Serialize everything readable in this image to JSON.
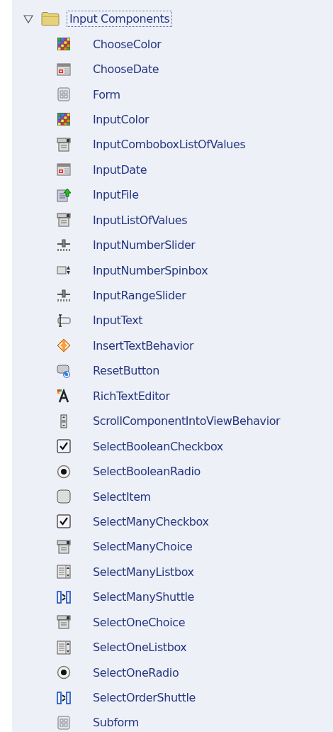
{
  "tree": {
    "label": "Input Components",
    "expanded": true,
    "selected": true,
    "children": [
      {
        "label": "ChooseColor",
        "kind": "color",
        "selected": false
      },
      {
        "label": "ChooseDate",
        "kind": "date",
        "selected": false
      },
      {
        "label": "Form",
        "kind": "form",
        "selected": false
      },
      {
        "label": "InputColor",
        "kind": "color",
        "selected": false
      },
      {
        "label": "InputComboboxListOfValues",
        "kind": "combo",
        "selected": false
      },
      {
        "label": "InputDate",
        "kind": "date",
        "selected": false
      },
      {
        "label": "InputFile",
        "kind": "file",
        "selected": false
      },
      {
        "label": "InputListOfValues",
        "kind": "combo",
        "selected": false
      },
      {
        "label": "InputNumberSlider",
        "kind": "slider",
        "selected": false
      },
      {
        "label": "InputNumberSpinbox",
        "kind": "spinbox",
        "selected": false
      },
      {
        "label": "InputRangeSlider",
        "kind": "slider",
        "selected": false
      },
      {
        "label": "InputText",
        "kind": "text",
        "selected": false
      },
      {
        "label": "InsertTextBehavior",
        "kind": "behavior",
        "selected": false
      },
      {
        "label": "ResetButton",
        "kind": "reset",
        "selected": false
      },
      {
        "label": "RichTextEditor",
        "kind": "richtext",
        "selected": false
      },
      {
        "label": "ScrollComponentIntoViewBehavior",
        "kind": "scroll",
        "selected": false
      },
      {
        "label": "SelectBooleanCheckbox",
        "kind": "checkbox",
        "selected": false
      },
      {
        "label": "SelectBooleanRadio",
        "kind": "radio",
        "selected": false
      },
      {
        "label": "SelectItem",
        "kind": "item",
        "selected": false
      },
      {
        "label": "SelectManyCheckbox",
        "kind": "checkbox",
        "selected": false
      },
      {
        "label": "SelectManyChoice",
        "kind": "combo",
        "selected": false
      },
      {
        "label": "SelectManyListbox",
        "kind": "listbox",
        "selected": false
      },
      {
        "label": "SelectManyShuttle",
        "kind": "shuttle",
        "selected": false
      },
      {
        "label": "SelectOneChoice",
        "kind": "combo",
        "selected": false
      },
      {
        "label": "SelectOneListbox",
        "kind": "listbox",
        "selected": false
      },
      {
        "label": "SelectOneRadio",
        "kind": "radio",
        "selected": false
      },
      {
        "label": "SelectOrderShuttle",
        "kind": "shuttle",
        "selected": false
      },
      {
        "label": "Subform",
        "kind": "form",
        "selected": false
      }
    ]
  }
}
